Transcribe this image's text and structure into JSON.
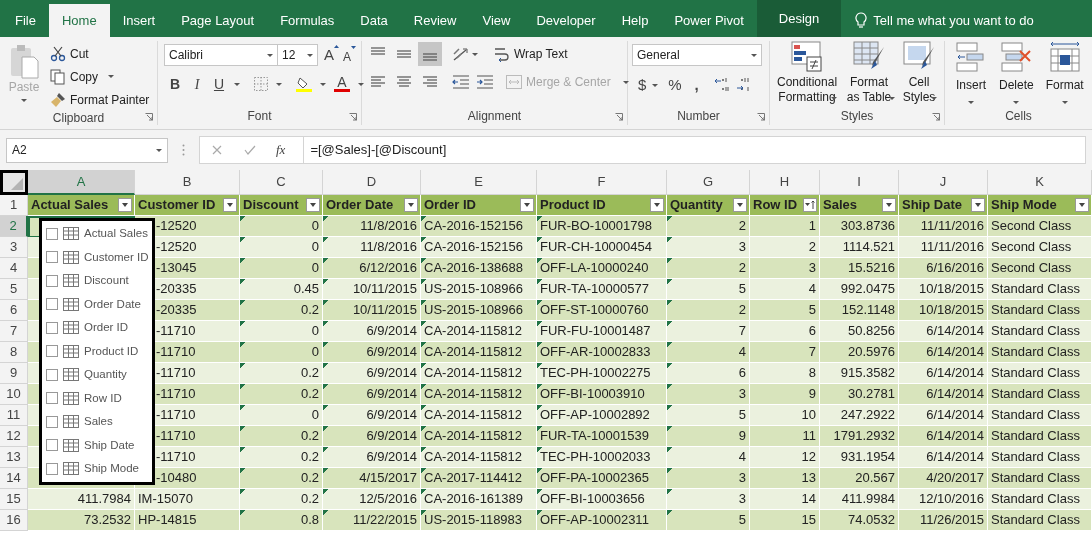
{
  "ribbon_tabs": [
    {
      "label": "File",
      "selected": false,
      "kind": "normal"
    },
    {
      "label": "Home",
      "selected": true,
      "kind": "normal"
    },
    {
      "label": "Insert",
      "selected": false,
      "kind": "normal"
    },
    {
      "label": "Page Layout",
      "selected": false,
      "kind": "normal"
    },
    {
      "label": "Formulas",
      "selected": false,
      "kind": "normal"
    },
    {
      "label": "Data",
      "selected": false,
      "kind": "normal"
    },
    {
      "label": "Review",
      "selected": false,
      "kind": "normal"
    },
    {
      "label": "View",
      "selected": false,
      "kind": "normal"
    },
    {
      "label": "Developer",
      "selected": false,
      "kind": "normal"
    },
    {
      "label": "Help",
      "selected": false,
      "kind": "normal"
    },
    {
      "label": "Power Pivot",
      "selected": false,
      "kind": "normal"
    },
    {
      "label": "Design",
      "selected": false,
      "kind": "contextual"
    }
  ],
  "tell_me": "Tell me what you want to do",
  "clipboard": {
    "paste": "Paste",
    "paste_disabled": true,
    "cut": "Cut",
    "copy": "Copy",
    "format_painter": "Format Painter",
    "label": "Clipboard"
  },
  "font": {
    "font_name": "Calibri",
    "font_size": "12",
    "grow": "A",
    "shrink": "A",
    "bold": "B",
    "italic": "I",
    "underline": "U",
    "font_color": "A",
    "label": "Font"
  },
  "alignment": {
    "wrap_text": "Wrap Text",
    "merge_center": "Merge & Center",
    "merge_disabled": true,
    "label": "Alignment"
  },
  "number": {
    "format": "General",
    "currency": "$",
    "percent": "%",
    "comma": ",",
    "label": "Number"
  },
  "styles": {
    "buttons": [
      {
        "label": "Conditional Formatting",
        "kind": "conditional"
      },
      {
        "label": "Format as Table",
        "kind": "table"
      },
      {
        "label": "Cell Styles",
        "kind": "cell"
      }
    ],
    "label": "Styles"
  },
  "cells": {
    "buttons": [
      {
        "label": "Insert",
        "kind": "insert"
      },
      {
        "label": "Delete",
        "kind": "delete"
      },
      {
        "label": "Format",
        "kind": "format"
      }
    ],
    "label": "Cells"
  },
  "formula_bar": {
    "name_box": "A2",
    "fx": "fx",
    "formula": "=[@Sales]-[@Discount]"
  },
  "columns": [
    {
      "letter": "A",
      "selected": true
    },
    {
      "letter": "B",
      "selected": false
    },
    {
      "letter": "C",
      "selected": false
    },
    {
      "letter": "D",
      "selected": false
    },
    {
      "letter": "E",
      "selected": false
    },
    {
      "letter": "F",
      "selected": false
    },
    {
      "letter": "G",
      "selected": false
    },
    {
      "letter": "H",
      "selected": false
    },
    {
      "letter": "I",
      "selected": false
    },
    {
      "letter": "J",
      "selected": false
    },
    {
      "letter": "K",
      "selected": false
    }
  ],
  "header_row": {
    "row": "1",
    "headers": [
      {
        "label": "Actual Sales",
        "kind": "filter"
      },
      {
        "label": "Customer ID",
        "kind": "filter"
      },
      {
        "label": "Discount",
        "kind": "filter"
      },
      {
        "label": "Order Date",
        "kind": "filter"
      },
      {
        "label": "Order ID",
        "kind": "filter"
      },
      {
        "label": "Product ID",
        "kind": "filter"
      },
      {
        "label": "Quantity",
        "kind": "filter"
      },
      {
        "label": "Row ID",
        "kind": "sort"
      },
      {
        "label": "Sales",
        "kind": "filter"
      },
      {
        "label": "Ship Date",
        "kind": "filter"
      },
      {
        "label": "Ship Mode",
        "kind": "filter"
      }
    ]
  },
  "rows": [
    {
      "row": "2",
      "selected": true,
      "cells": [
        "-12520",
        "0",
        "11/8/2016",
        "CA-2016-152156",
        "FUR-BO-10001798",
        "2",
        "1",
        "303.8736",
        "11/11/2016",
        "Second Class"
      ]
    },
    {
      "row": "3",
      "selected": false,
      "cells": [
        "-12520",
        "0",
        "11/8/2016",
        "CA-2016-152156",
        "FUR-CH-10000454",
        "3",
        "2",
        "1114.521",
        "11/11/2016",
        "Second Class"
      ]
    },
    {
      "row": "4",
      "selected": false,
      "cells": [
        "-13045",
        "0",
        "6/12/2016",
        "CA-2016-138688",
        "OFF-LA-10000240",
        "2",
        "3",
        "15.5216",
        "6/16/2016",
        "Second Class"
      ]
    },
    {
      "row": "5",
      "selected": false,
      "cells": [
        "-20335",
        "0.45",
        "10/11/2015",
        "US-2015-108966",
        "FUR-TA-10000577",
        "5",
        "4",
        "992.0475",
        "10/18/2015",
        "Standard Class"
      ]
    },
    {
      "row": "6",
      "selected": false,
      "cells": [
        "-20335",
        "0.2",
        "10/11/2015",
        "US-2015-108966",
        "OFF-ST-10000760",
        "2",
        "5",
        "152.1148",
        "10/18/2015",
        "Standard Class"
      ]
    },
    {
      "row": "7",
      "selected": false,
      "cells": [
        "-11710",
        "0",
        "6/9/2014",
        "CA-2014-115812",
        "FUR-FU-10001487",
        "7",
        "6",
        "50.8256",
        "6/14/2014",
        "Standard Class"
      ]
    },
    {
      "row": "8",
      "selected": false,
      "cells": [
        "-11710",
        "0",
        "6/9/2014",
        "CA-2014-115812",
        "OFF-AR-10002833",
        "4",
        "7",
        "20.5976",
        "6/14/2014",
        "Standard Class"
      ]
    },
    {
      "row": "9",
      "selected": false,
      "cells": [
        "-11710",
        "0.2",
        "6/9/2014",
        "CA-2014-115812",
        "TEC-PH-10002275",
        "6",
        "8",
        "915.3582",
        "6/14/2014",
        "Standard Class"
      ]
    },
    {
      "row": "10",
      "selected": false,
      "cells": [
        "-11710",
        "0.2",
        "6/9/2014",
        "CA-2014-115812",
        "OFF-BI-10003910",
        "3",
        "9",
        "30.2781",
        "6/14/2014",
        "Standard Class"
      ]
    },
    {
      "row": "11",
      "selected": false,
      "cells": [
        "-11710",
        "0",
        "6/9/2014",
        "CA-2014-115812",
        "OFF-AP-10002892",
        "5",
        "10",
        "247.2922",
        "6/14/2014",
        "Standard Class"
      ]
    },
    {
      "row": "12",
      "selected": false,
      "cells": [
        "-11710",
        "0.2",
        "6/9/2014",
        "CA-2014-115812",
        "FUR-TA-10001539",
        "9",
        "11",
        "1791.2932",
        "6/14/2014",
        "Standard Class"
      ]
    },
    {
      "row": "13",
      "selected": false,
      "cells": [
        "-11710",
        "0.2",
        "6/9/2014",
        "CA-2014-115812",
        "TEC-PH-10002033",
        "4",
        "12",
        "931.1954",
        "6/14/2014",
        "Standard Class"
      ]
    },
    {
      "row": "14",
      "selected": false,
      "cells": [
        "-10480",
        "0.2",
        "4/15/2017",
        "CA-2017-114412",
        "OFF-PA-10002365",
        "3",
        "13",
        "20.567",
        "4/20/2017",
        "Standard Class"
      ]
    },
    {
      "row": "15",
      "selected": false,
      "actual_sales": "411.7984",
      "cells": [
        "IM-15070",
        "0.2",
        "12/5/2016",
        "CA-2016-161389",
        "OFF-BI-10003656",
        "3",
        "14",
        "411.9984",
        "12/10/2016",
        "Standard Class"
      ]
    },
    {
      "row": "16",
      "selected": false,
      "actual_sales": "73.2532",
      "cells": [
        "HP-14815",
        "0.8",
        "11/22/2015",
        "US-2015-118983",
        "OFF-AP-10002311",
        "5",
        "15",
        "74.0532",
        "11/26/2015",
        "Standard Class"
      ]
    }
  ],
  "field_list": [
    {
      "label": "Actual Sales",
      "checked": false
    },
    {
      "label": "Customer ID",
      "checked": false
    },
    {
      "label": "Discount",
      "checked": false
    },
    {
      "label": "Order Date",
      "checked": false
    },
    {
      "label": "Order ID",
      "checked": false
    },
    {
      "label": "Product ID",
      "checked": false
    },
    {
      "label": "Quantity",
      "checked": false
    },
    {
      "label": "Row ID",
      "checked": false
    },
    {
      "label": "Sales",
      "checked": false
    },
    {
      "label": "Ship Date",
      "checked": false
    },
    {
      "label": "Ship Mode",
      "checked": false
    }
  ]
}
